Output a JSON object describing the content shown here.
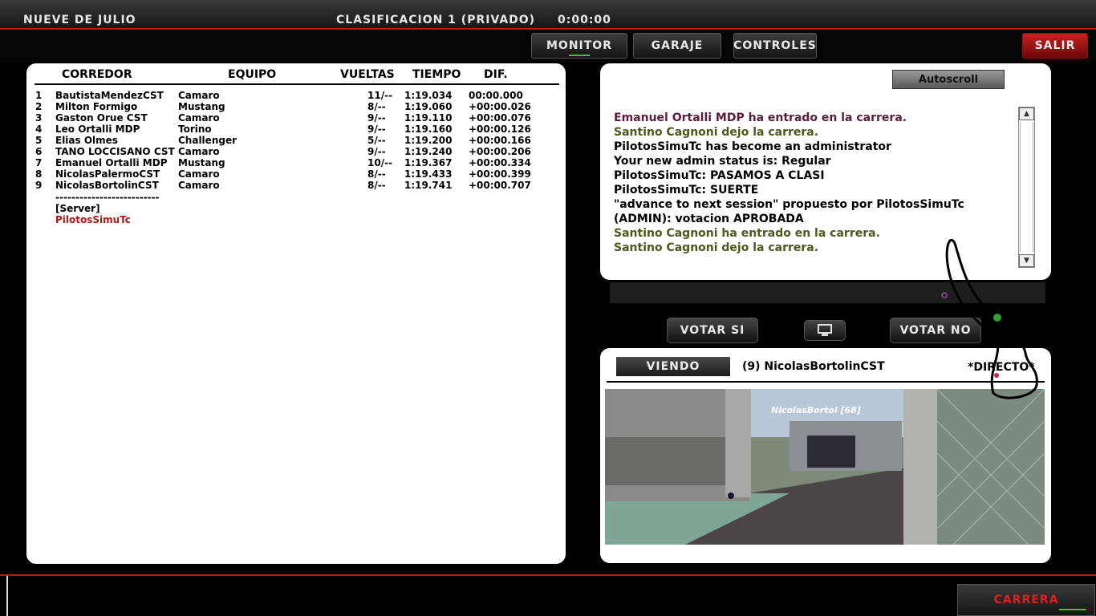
{
  "header": {
    "track": "NUEVE DE JULIO",
    "session": "CLASIFICACION 1 (PRIVADO)",
    "clock": "0:00:00"
  },
  "nav": {
    "monitor": "MONITOR",
    "garaje": "GARAJE",
    "controles": "CONTROLES",
    "salir": "SALIR"
  },
  "standings": {
    "headers": {
      "driver": "CORREDOR",
      "team": "EQUIPO",
      "laps": "VUELTAS",
      "time": "TIEMPO",
      "dif": "DIF."
    },
    "rows": [
      {
        "pos": "1",
        "driver": "BautistaMendezCST",
        "team": "Camaro",
        "laps": "11/--",
        "time": "1:19.034",
        "dif": "00:00.000"
      },
      {
        "pos": "2",
        "driver": "Milton Formigo",
        "team": "Mustang",
        "laps": "8/--",
        "time": "1:19.060",
        "dif": "+00:00.026"
      },
      {
        "pos": "3",
        "driver": "Gaston Orue CST",
        "team": "Camaro",
        "laps": "9/--",
        "time": "1:19.110",
        "dif": "+00:00.076"
      },
      {
        "pos": "4",
        "driver": "Leo Ortalli MDP",
        "team": "Torino",
        "laps": "9/--",
        "time": "1:19.160",
        "dif": "+00:00.126"
      },
      {
        "pos": "5",
        "driver": "Elias Olmes",
        "team": "Challenger",
        "laps": "5/--",
        "time": "1:19.200",
        "dif": "+00:00.166"
      },
      {
        "pos": "6",
        "driver": "TANO LOCCISANO CST",
        "team": "Camaro",
        "laps": "9/--",
        "time": "1:19.240",
        "dif": "+00:00.206"
      },
      {
        "pos": "7",
        "driver": "Emanuel Ortalli MDP",
        "team": "Mustang",
        "laps": "10/--",
        "time": "1:19.367",
        "dif": "+00:00.334"
      },
      {
        "pos": "8",
        "driver": "NicolasPalermoCST",
        "team": "Camaro",
        "laps": "8/--",
        "time": "1:19.433",
        "dif": "+00:00.399"
      },
      {
        "pos": "9",
        "driver": "NicolasBortolinCST",
        "team": "Camaro",
        "laps": "8/--",
        "time": "1:19.741",
        "dif": "+00:00.707"
      }
    ],
    "separator": "--------------------------",
    "server_label": "[Server]",
    "server_user": "PilotosSimuTc"
  },
  "chat": {
    "autoscroll": "Autoscroll",
    "messages": [
      {
        "text": "Emanuel Ortalli MDP ha entrado en la carrera.",
        "color": "#5a1c3c"
      },
      {
        "text": "Santino Cagnoni dejo la carrera.",
        "color": "#4a5a1c"
      },
      {
        "text": "PilotosSimuTc has become an administrator",
        "color": "#000000"
      },
      {
        "text": "Your new admin status is: Regular",
        "color": "#000000"
      },
      {
        "text": "PilotosSimuTc: PASAMOS A CLASI",
        "color": "#000000"
      },
      {
        "text": "PilotosSimuTc: SUERTE",
        "color": "#000000"
      },
      {
        "text": "\"advance to next session\" propuesto por  PilotosSimuTc",
        "color": "#000000"
      },
      {
        "text": "(ADMIN): votacion APROBADA",
        "color": "#000000"
      },
      {
        "text": "Santino Cagnoni ha entrado en la carrera.",
        "color": "#4a5a1c"
      },
      {
        "text": "Santino Cagnoni dejo la carrera.",
        "color": "#4a5a1c"
      }
    ]
  },
  "vote": {
    "yes": "VOTAR SI",
    "no": "VOTAR NO"
  },
  "viewer": {
    "viendo": "VIENDO",
    "viewing": "(9) NicolasBortolinCST",
    "mode": "*DIRECTO*",
    "camera_label": "NicolasBortol  [68]"
  },
  "footer": {
    "carrera": "CARRERA"
  },
  "colors": {
    "accent_red": "#c01818",
    "active_green": "#2ed02e",
    "server_user": "#b01818"
  }
}
